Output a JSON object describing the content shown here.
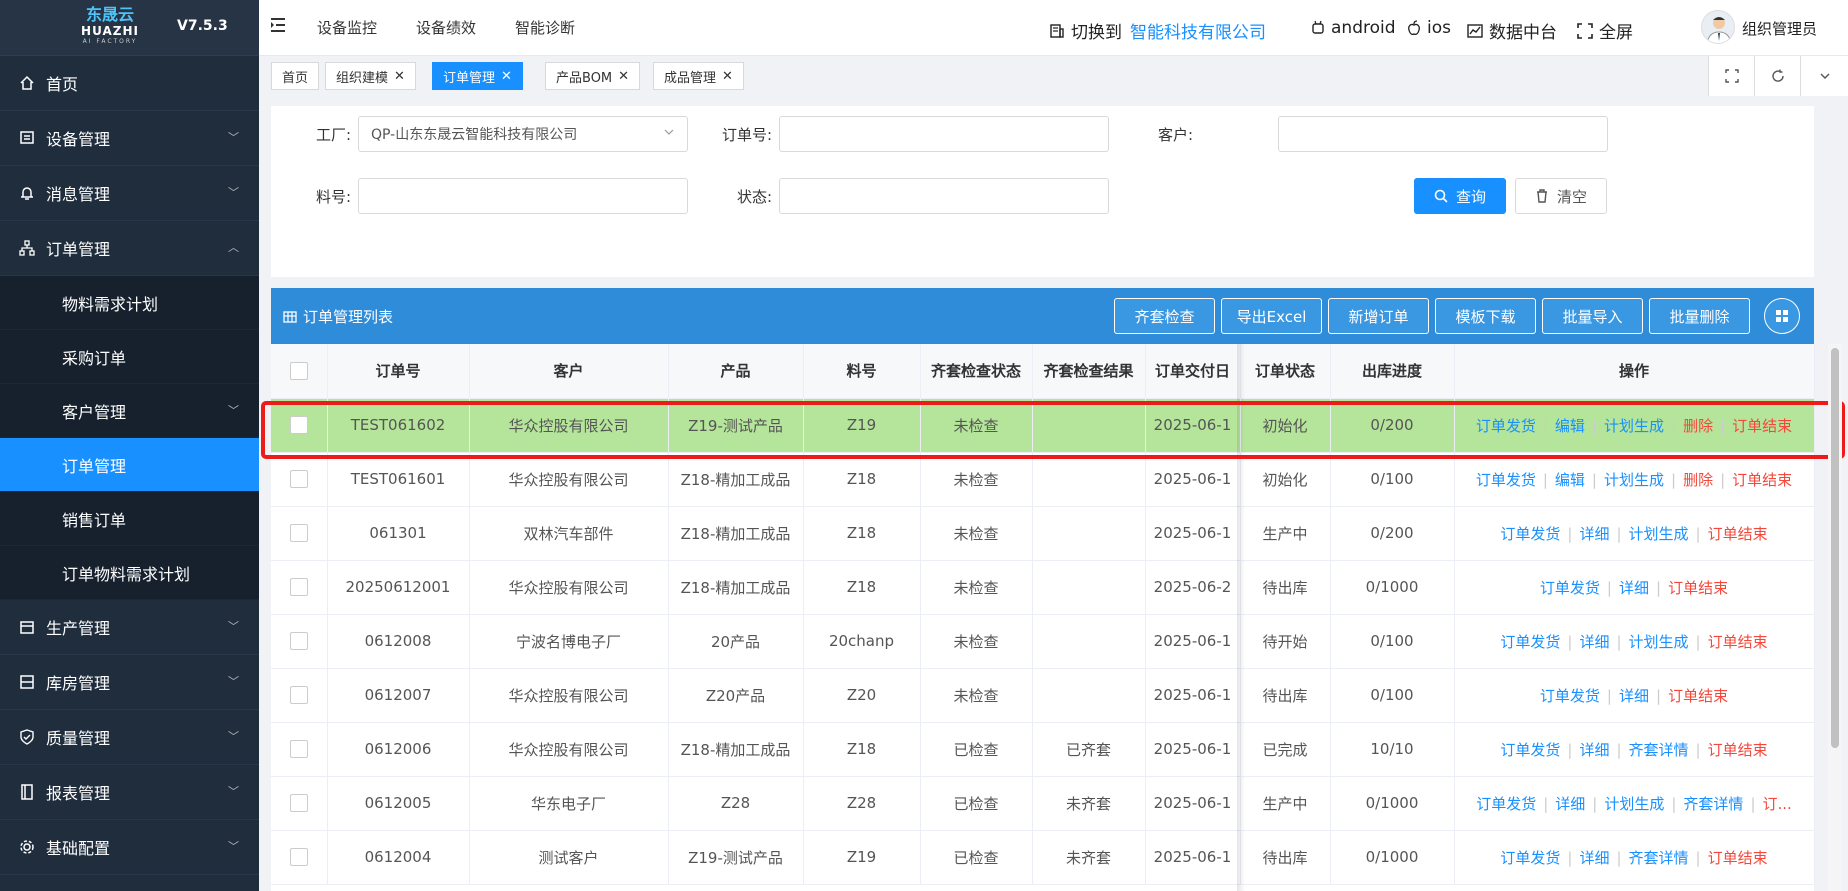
{
  "brand": {
    "name_cn": "东晟云",
    "name_en": "HUAZHI",
    "sub": "AI FACTORY",
    "version": "V7.5.3"
  },
  "sidebar": {
    "items": [
      {
        "label": "首页",
        "icon": "home-icon"
      },
      {
        "label": "设备管理",
        "icon": "device-icon"
      },
      {
        "label": "消息管理",
        "icon": "bell-icon"
      },
      {
        "label": "订单管理",
        "icon": "sitemap-icon"
      },
      {
        "label": "生产管理",
        "icon": "calendar-icon"
      },
      {
        "label": "库房管理",
        "icon": "warehouse-icon"
      },
      {
        "label": "质量管理",
        "icon": "shield-icon"
      },
      {
        "label": "报表管理",
        "icon": "report-icon"
      },
      {
        "label": "基础配置",
        "icon": "gear-icon"
      }
    ],
    "sub_items": [
      "物料需求计划",
      "采购订单",
      "客户管理",
      "订单管理",
      "销售订单",
      "订单物料需求计划"
    ]
  },
  "topbar": {
    "nav": [
      "设备监控",
      "设备绩效",
      "智能诊断"
    ],
    "switch_label": "切换到",
    "company": "智能科技有限公司",
    "android": "android",
    "ios": "ios",
    "datacenter": "数据中台",
    "fullscreen": "全屏",
    "user": "组织管理员"
  },
  "tabs": [
    {
      "label": "首页"
    },
    {
      "label": "组织建模"
    },
    {
      "label": "订单管理"
    },
    {
      "label": "产品BOM"
    },
    {
      "label": "成品管理"
    }
  ],
  "search": {
    "factory_label": "工厂:",
    "factory_value": "QP-山东东晟云智能科技有限公司",
    "order_label": "订单号:",
    "customer_label": "客户:",
    "material_label": "料号:",
    "status_label": "状态:",
    "query_btn": "查询",
    "clear_btn": "清空"
  },
  "table": {
    "title": "订单管理列表",
    "buttons": [
      "齐套检查",
      "导出Excel",
      "新增订单",
      "模板下载",
      "批量导入",
      "批量删除"
    ],
    "columns": [
      "订单号",
      "客户",
      "产品",
      "料号",
      "齐套检查状态",
      "齐套检查结果",
      "订单交付日",
      "订单状态",
      "出库进度",
      "操作"
    ],
    "rows": [
      {
        "order": "TEST061602",
        "customer": "华众控股有限公司",
        "product": "Z19-测试产品",
        "material": "Z19",
        "check_status": "未检查",
        "check_result": "",
        "delivery": "2025-06-1",
        "status": "初始化",
        "progress": "0/200",
        "actions": [
          "订单发货",
          "编辑",
          "计划生成",
          "删除",
          "订单结束"
        ]
      },
      {
        "order": "TEST061601",
        "customer": "华众控股有限公司",
        "product": "Z18-精加工成品",
        "material": "Z18",
        "check_status": "未检查",
        "check_result": "",
        "delivery": "2025-06-1",
        "status": "初始化",
        "progress": "0/100",
        "actions": [
          "订单发货",
          "编辑",
          "计划生成",
          "删除",
          "订单结束"
        ]
      },
      {
        "order": "061301",
        "customer": "双林汽车部件",
        "product": "Z18-精加工成品",
        "material": "Z18",
        "check_status": "未检查",
        "check_result": "",
        "delivery": "2025-06-1",
        "status": "生产中",
        "progress": "0/200",
        "actions": [
          "订单发货",
          "详细",
          "计划生成",
          "订单结束"
        ]
      },
      {
        "order": "20250612001",
        "customer": "华众控股有限公司",
        "product": "Z18-精加工成品",
        "material": "Z18",
        "check_status": "未检查",
        "check_result": "",
        "delivery": "2025-06-2",
        "status": "待出库",
        "progress": "0/1000",
        "actions": [
          "订单发货",
          "详细",
          "订单结束"
        ]
      },
      {
        "order": "0612008",
        "customer": "宁波名博电子厂",
        "product": "20产品",
        "material": "20chanp",
        "check_status": "未检查",
        "check_result": "",
        "delivery": "2025-06-1",
        "status": "待开始",
        "progress": "0/100",
        "actions": [
          "订单发货",
          "详细",
          "计划生成",
          "订单结束"
        ]
      },
      {
        "order": "0612007",
        "customer": "华众控股有限公司",
        "product": "Z20产品",
        "material": "Z20",
        "check_status": "未检查",
        "check_result": "",
        "delivery": "2025-06-1",
        "status": "待出库",
        "progress": "0/100",
        "actions": [
          "订单发货",
          "详细",
          "订单结束"
        ]
      },
      {
        "order": "0612006",
        "customer": "华众控股有限公司",
        "product": "Z18-精加工成品",
        "material": "Z18",
        "check_status": "已检查",
        "check_result": "已齐套",
        "delivery": "2025-06-1",
        "status": "已完成",
        "progress": "10/10",
        "actions": [
          "订单发货",
          "详细",
          "齐套详情",
          "订单结束"
        ]
      },
      {
        "order": "0612005",
        "customer": "华东电子厂",
        "product": "Z28",
        "material": "Z28",
        "check_status": "已检查",
        "check_result": "未齐套",
        "delivery": "2025-06-1",
        "status": "生产中",
        "progress": "0/1000",
        "actions": [
          "订单发货",
          "详细",
          "计划生成",
          "齐套详情",
          "订..."
        ]
      },
      {
        "order": "0612004",
        "customer": "测试客户",
        "product": "Z19-测试产品",
        "material": "Z19",
        "check_status": "已检查",
        "check_result": "未齐套",
        "delivery": "2025-06-1",
        "status": "待出库",
        "progress": "0/1000",
        "actions": [
          "订单发货",
          "详细",
          "齐套详情",
          "订单结束"
        ]
      }
    ]
  }
}
